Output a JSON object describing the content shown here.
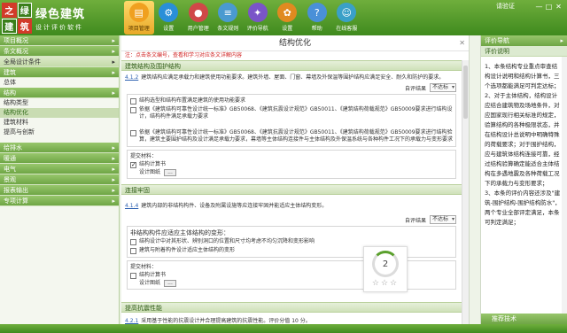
{
  "app": {
    "logo_chars": [
      "之",
      "绿",
      "建",
      "筑"
    ],
    "title": "绿色建筑",
    "subtitle": "设计评价软件"
  },
  "nav": [
    {
      "label": "项目管理",
      "icon": "folder-icon",
      "color": "#f0a020",
      "active": true
    },
    {
      "label": "设置",
      "icon": "gear-icon",
      "color": "#2a8fd8"
    },
    {
      "label": "用户管理",
      "icon": "user-icon",
      "color": "#d04848"
    },
    {
      "label": "条文规则",
      "icon": "rules-icon",
      "color": "#4a9ad0"
    },
    {
      "label": "评价导航",
      "icon": "compass-icon",
      "color": "#7a55c8"
    },
    {
      "label": "设置",
      "icon": "settings-icon",
      "color": "#e08a20"
    },
    {
      "label": "帮助",
      "icon": "help-icon",
      "color": "#4a90d8"
    },
    {
      "label": "在线客服",
      "icon": "service-icon",
      "color": "#3aa0c8"
    }
  ],
  "window": {
    "greeting": "请验证",
    "min": "—",
    "max": "□",
    "close": "✕"
  },
  "sidebar": {
    "items": [
      {
        "type": "head",
        "label": "项目概况"
      },
      {
        "type": "head",
        "label": "条文概况"
      },
      {
        "type": "head",
        "label": "全局设计条件",
        "selected": true
      },
      {
        "type": "head",
        "label": "建筑"
      },
      {
        "type": "sub",
        "label": "总体"
      },
      {
        "type": "head",
        "label": "结构"
      },
      {
        "type": "sub",
        "label": "结构类型"
      },
      {
        "type": "sub",
        "label": "结构优化",
        "highlight": true
      },
      {
        "type": "sub",
        "label": "建筑材料"
      },
      {
        "type": "sub",
        "label": "提高与创新"
      },
      {
        "type": "gap"
      },
      {
        "type": "head",
        "label": "给排水"
      },
      {
        "type": "head",
        "label": "暖通"
      },
      {
        "type": "head",
        "label": "电气"
      },
      {
        "type": "head",
        "label": "景观"
      },
      {
        "type": "head",
        "label": "报表输出"
      },
      {
        "type": "head",
        "label": "专项计算"
      }
    ]
  },
  "main": {
    "title": "结构优化",
    "close": "✕",
    "notice": "注：点击条文编号，查看和学习对应条文详解内容",
    "sections": [
      {
        "head": "建筑结构及围护结构",
        "clause_num": "4.1.2",
        "clause_text": "建筑结构应满足承载力和建筑使用功能要求。建筑外墙、屋面、门窗、幕墙及外保温等围护结构应满足安全、耐久和防护的要求。",
        "eval_label": "自评结果",
        "eval_value": "不达标",
        "options": [
          {
            "checked": false,
            "text": "结构选型和结构布置满足建筑的使用功能要求"
          },
          {
            "checked": false,
            "text": "依据《建筑结构可靠性设计统一标准》GB50068、《建筑抗震设计规范》GB50011、《建筑结构荷载规范》GB50009要求进行结构设计，结构构件满足承载力要求"
          },
          {
            "checked": false,
            "text": ""
          },
          {
            "checked": false,
            "text": "依据《建筑结构可靠性设计统一标准》GB50068、《建筑抗震设计规范》GB50011、《建筑结构荷载规范》GB50009要求进行结构验算，建筑主要围护结构及设计满足承载力要求，幕墙等主体结构连接件与主体结构及外保温系统与各种构件工况下的承载力与变形要求"
          }
        ],
        "materials_label": "提交材料：",
        "material_item": "结构计算书",
        "material_checked": true,
        "upload_label": "设计图纸",
        "upload_btn": "..."
      },
      {
        "head": "连接牢固",
        "clause_num": "4.1.4",
        "clause_text": "建筑内部的非结构构件、设备及附属设施等应连接牢固并能适应主体结构变形。",
        "eval_label": "自评结果",
        "eval_value": "不达标",
        "options_title": "非结构构件应适应主体结构的变形：",
        "options": [
          {
            "checked": false,
            "text": "结构设计中对其形状、辨别洞口的位置和尺寸均考虑不均匀沉降和变形影响"
          },
          {
            "checked": false,
            "text": "建筑与附着构件设计适应主体结构的变形"
          }
        ],
        "materials_label": "提交材料：",
        "material_item": "结构计算书",
        "material_checked": false,
        "upload_label": "设计图纸",
        "upload_btn": "..."
      },
      {
        "head": "提高抗震性能",
        "clause_num": "4.2.1",
        "clause_text": "采用基于性能的抗震设计并合理提高建筑的抗震性能。评价分值 10 分。"
      }
    ]
  },
  "score_widget": {
    "score": "2",
    "stars": "☆☆☆"
  },
  "right": {
    "head": "评价导航",
    "sub": "评价说明",
    "body": "1、本条结构专业重点审查结构设计说明和结构计算书，三个选项都能满足可判定达标；\n2、对于主体结构，结构设计应结合建筑物及场地条件，对应国家现行相关标准的规定，验算结构的各种极限状态，并在结构设计总说明中明确特殊的荷载要求；对于围护结构，应与建筑体结构连接可靠，经过结构验算确定能适合主体结构在多遇地震及各种荷载工况下的承载力与变形要求；\n3、本条的评价内容还涉及\"建筑-围护结构-围护结构防水\"，两个专业全部评定满足，本条可判定满足；",
    "foot": "推荐技术"
  }
}
